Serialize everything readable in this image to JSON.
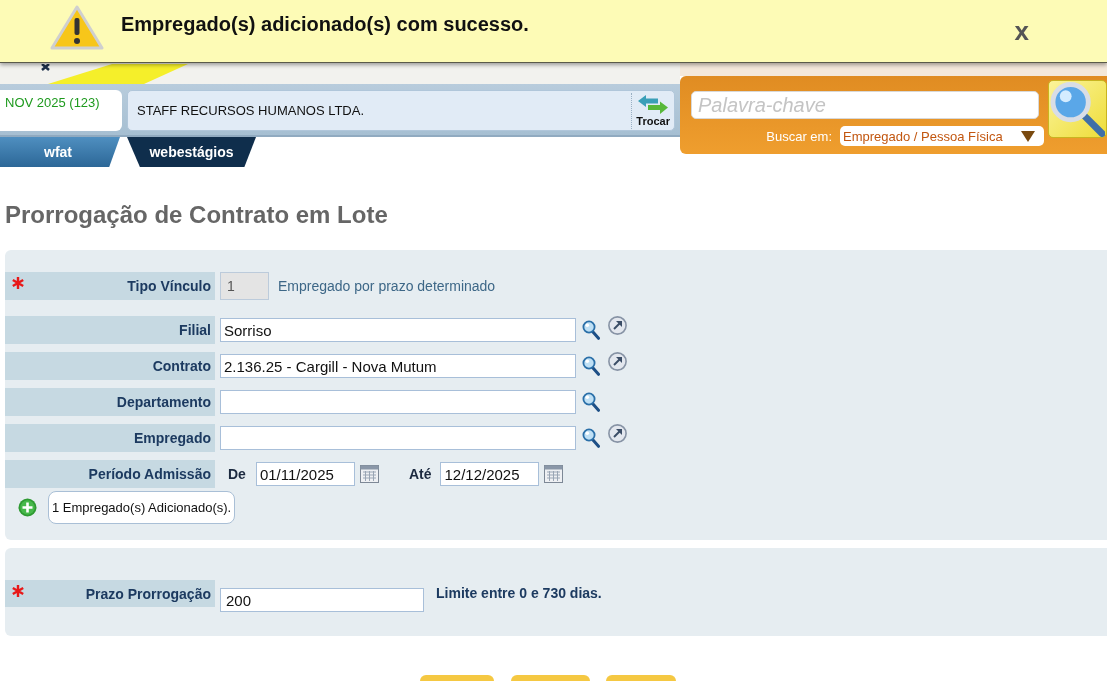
{
  "notification": {
    "message": "Empregado(s) adicionado(s) com sucesso.",
    "close": "x"
  },
  "header": {
    "period": "NOV 2025 (123)",
    "company": "STAFF RECURSOS HUMANOS LTDA.",
    "switch_button": "Trocar",
    "tabs": [
      {
        "label": "wfat",
        "selected": false
      },
      {
        "label": "webestágios",
        "selected": true
      }
    ]
  },
  "search": {
    "placeholder": "Palavra-chave",
    "scope_label": "Buscar em:",
    "scope": "Empregado / Pessoa Física"
  },
  "page_title": "Prorrogação de Contrato em Lote",
  "form": {
    "fields": [
      {
        "kind": "code",
        "label": "Tipo Vínculo",
        "required": true,
        "disabled": true,
        "open_link": false,
        "value": "1",
        "description": "Empregado por prazo determinado"
      },
      {
        "kind": "lookup",
        "label": "Filial",
        "required": false,
        "disabled": false,
        "open_link": true,
        "value": "Sorriso"
      },
      {
        "kind": "lookup",
        "label": "Contrato",
        "required": false,
        "disabled": false,
        "open_link": true,
        "value": "2.136.25 - Cargill - Nova Mutum"
      },
      {
        "kind": "lookup",
        "label": "Departamento",
        "required": false,
        "disabled": false,
        "open_link": false
      },
      {
        "kind": "lookup",
        "label": "Empregado",
        "required": false,
        "disabled": false,
        "open_link": true
      },
      {
        "kind": "date_range",
        "label": "Período Admissão",
        "required": false,
        "disabled": false,
        "open_link": false,
        "from_label": "De",
        "from": "01/11/2025",
        "to_label": "Até",
        "to": "12/12/2025"
      }
    ],
    "added_note": "1 Empregado(s) Adicionado(s)."
  },
  "extension": {
    "label": "Prazo Prorrogação",
    "required": true,
    "value": "200",
    "hint": "Limite entre 0 e 730 dias."
  }
}
